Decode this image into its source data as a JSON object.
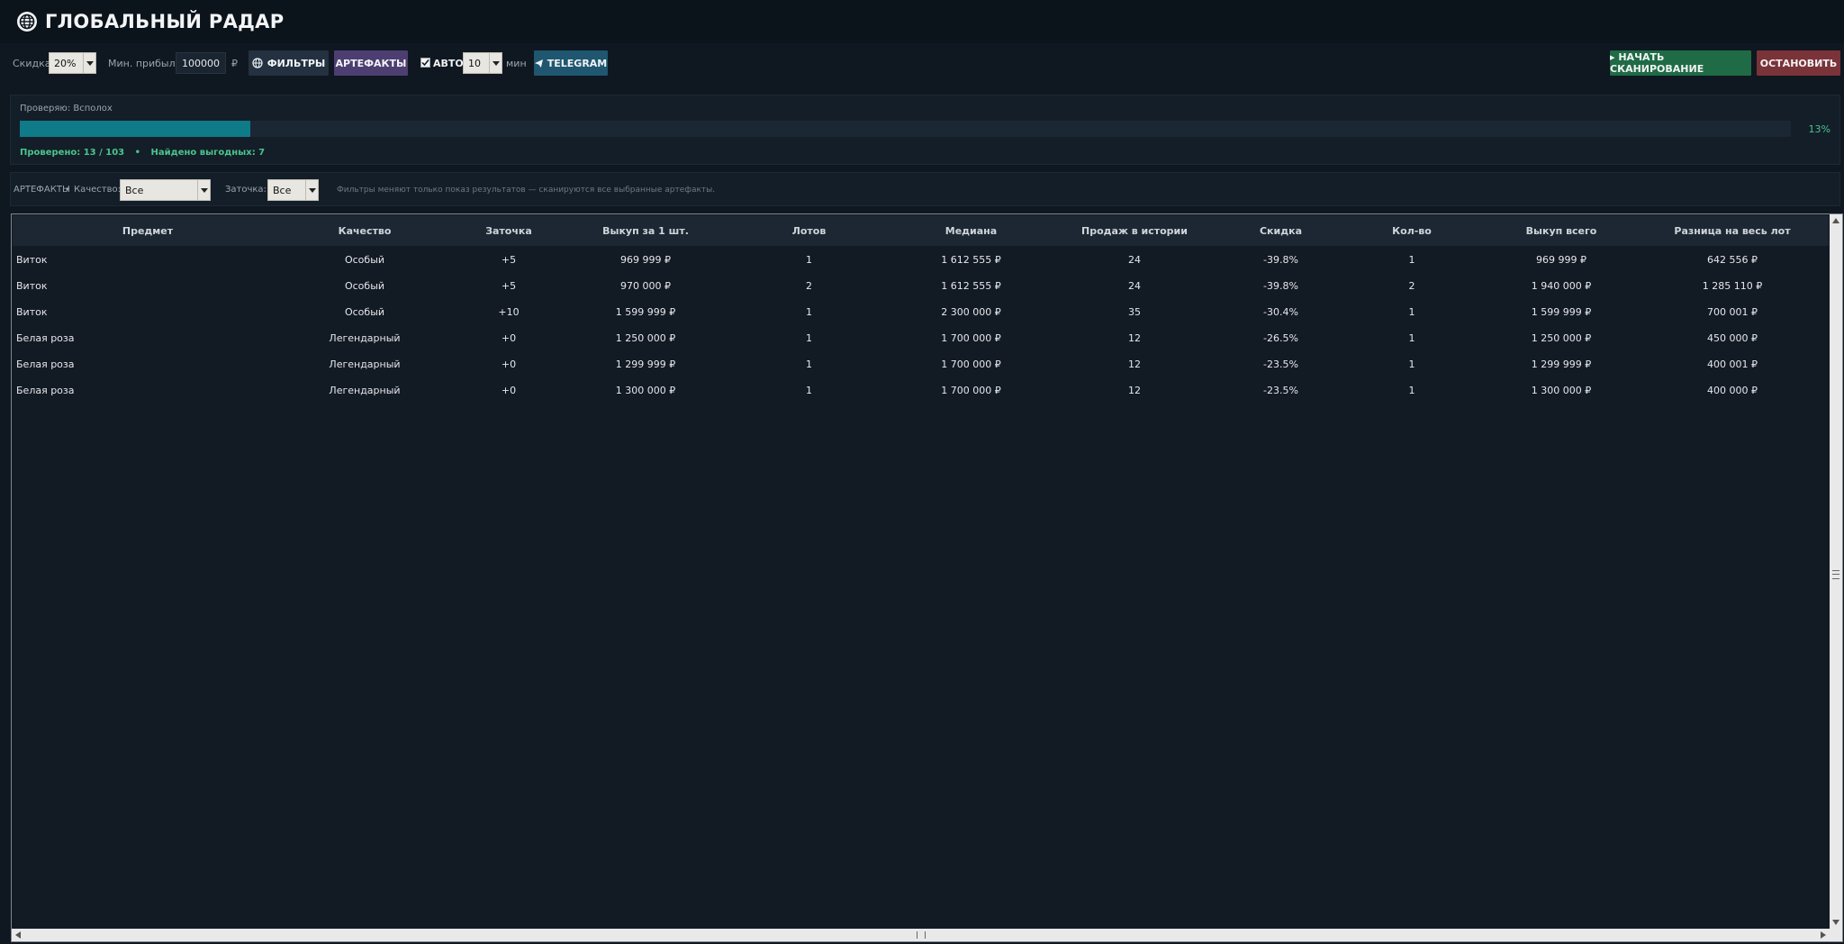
{
  "app": {
    "title": "ГЛОБАЛЬНЫЙ РАДАР",
    "icon": "globe-icon"
  },
  "toolbar": {
    "discount_label": "Скидка:",
    "discount_value": "20%",
    "min_profit_label": "Мин. прибыль:",
    "min_profit_value": "100000",
    "currency": "₽",
    "filters_label": "ФИЛЬТРЫ",
    "artifacts_label": "АРТЕФАКТЫ",
    "auto_checked": true,
    "auto_label": "АВТО",
    "interval_value": "10",
    "interval_unit": "мин",
    "telegram_label": "TELEGRAM",
    "start_label": "▸ НАЧАТЬ СКАНИРОВАНИЕ",
    "stop_label": "ОСТАНОВИТЬ"
  },
  "progress": {
    "checking_text": "Проверяю: Всполох",
    "percent_value": 13,
    "percent_text": "13%",
    "checked_text": "Проверено: 13 / 103",
    "separator": "•",
    "found_text": "Найдено выгодных: 7"
  },
  "filters": {
    "section_label": "АРТЕФАКТЫ",
    "separator": "•",
    "quality_label": "Качество:",
    "quality_value": "Все",
    "upgrade_label": "Заточка:",
    "upgrade_value": "Все",
    "hint": "Фильтры меняют только показ результатов — сканируются все выбранные артефакты."
  },
  "table": {
    "columns": [
      "Предмет",
      "Качество",
      "Заточка",
      "Выкуп за 1 шт.",
      "Лотов",
      "Медиана",
      "Продаж в истории",
      "Скидка",
      "Кол-во",
      "Выкуп всего",
      "Разница на весь лот"
    ],
    "rows": [
      [
        "Виток",
        "Особый",
        "+5",
        "969 999 ₽",
        "1",
        "1 612 555 ₽",
        "24",
        "-39.8%",
        "1",
        "969 999 ₽",
        "642 556 ₽"
      ],
      [
        "Виток",
        "Особый",
        "+5",
        "970 000 ₽",
        "2",
        "1 612 555 ₽",
        "24",
        "-39.8%",
        "2",
        "1 940 000 ₽",
        "1 285 110 ₽"
      ],
      [
        "Виток",
        "Особый",
        "+10",
        "1 599 999 ₽",
        "1",
        "2 300 000 ₽",
        "35",
        "-30.4%",
        "1",
        "1 599 999 ₽",
        "700 001 ₽"
      ],
      [
        "Белая роза",
        "Легендарный",
        "+0",
        "1 250 000 ₽",
        "1",
        "1 700 000 ₽",
        "12",
        "-26.5%",
        "1",
        "1 250 000 ₽",
        "450 000 ₽"
      ],
      [
        "Белая роза",
        "Легендарный",
        "+0",
        "1 299 999 ₽",
        "1",
        "1 700 000 ₽",
        "12",
        "-23.5%",
        "1",
        "1 299 999 ₽",
        "400 001 ₽"
      ],
      [
        "Белая роза",
        "Легендарный",
        "+0",
        "1 300 000 ₽",
        "1",
        "1 700 000 ₽",
        "12",
        "-23.5%",
        "1",
        "1 300 000 ₽",
        "400 000 ₽"
      ]
    ]
  },
  "colors": {
    "background": "#0f1720",
    "progress_fill": "#0f7b88",
    "accent_green": "#4cc48a",
    "start_button": "#1f6b45",
    "stop_button": "#7a3338",
    "artifacts_button": "#4d3e72",
    "telegram_button": "#1f5670",
    "filters_button": "#233140"
  }
}
